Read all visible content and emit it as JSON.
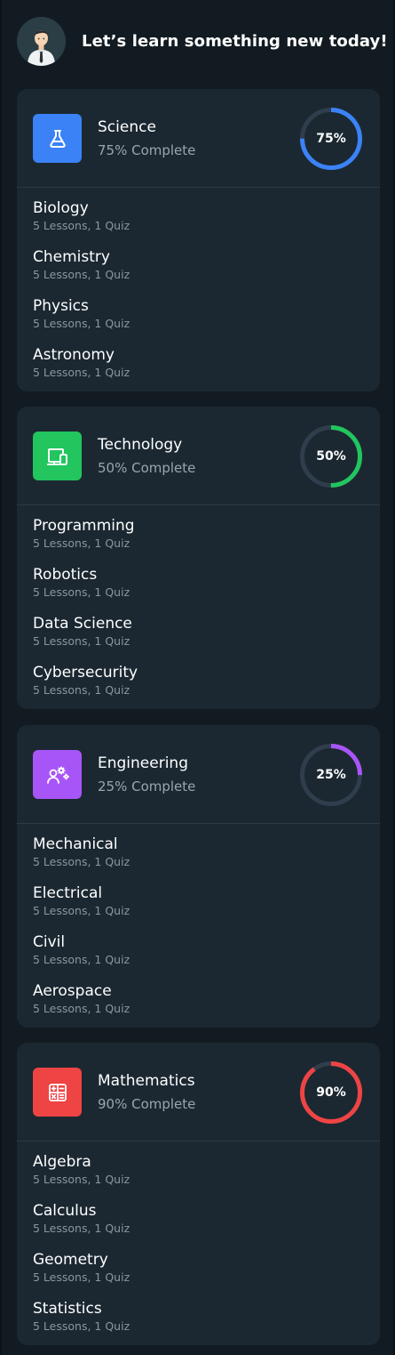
{
  "header": {
    "greeting": "Let’s learn something new today!",
    "avatar_icon": "user-avatar-icon"
  },
  "categories": [
    {
      "title": "Science",
      "subtitle": "75% Complete",
      "progress": 75,
      "progress_label": "75%",
      "color": "#3b82f6",
      "icon": "flask-icon",
      "topics": [
        {
          "name": "Biology",
          "meta": "5 Lessons, 1 Quiz"
        },
        {
          "name": "Chemistry",
          "meta": "5 Lessons, 1 Quiz"
        },
        {
          "name": "Physics",
          "meta": "5 Lessons, 1 Quiz"
        },
        {
          "name": "Astronomy",
          "meta": "5 Lessons, 1 Quiz"
        }
      ]
    },
    {
      "title": "Technology",
      "subtitle": "50% Complete",
      "progress": 50,
      "progress_label": "50%",
      "color": "#22c55e",
      "icon": "devices-icon",
      "topics": [
        {
          "name": "Programming",
          "meta": "5 Lessons, 1 Quiz"
        },
        {
          "name": "Robotics",
          "meta": "5 Lessons, 1 Quiz"
        },
        {
          "name": "Data Science",
          "meta": "5 Lessons, 1 Quiz"
        },
        {
          "name": "Cybersecurity",
          "meta": "5 Lessons, 1 Quiz"
        }
      ]
    },
    {
      "title": "Engineering",
      "subtitle": "25% Complete",
      "progress": 25,
      "progress_label": "25%",
      "color": "#a855f7",
      "icon": "engineer-gears-icon",
      "topics": [
        {
          "name": "Mechanical",
          "meta": "5 Lessons, 1 Quiz"
        },
        {
          "name": "Electrical",
          "meta": "5 Lessons, 1 Quiz"
        },
        {
          "name": "Civil",
          "meta": "5 Lessons, 1 Quiz"
        },
        {
          "name": "Aerospace",
          "meta": "5 Lessons, 1 Quiz"
        }
      ]
    },
    {
      "title": "Mathematics",
      "subtitle": "90% Complete",
      "progress": 90,
      "progress_label": "90%",
      "color": "#ef4444",
      "icon": "calculator-icon",
      "topics": [
        {
          "name": "Algebra",
          "meta": "5 Lessons, 1 Quiz"
        },
        {
          "name": "Calculus",
          "meta": "5 Lessons, 1 Quiz"
        },
        {
          "name": "Geometry",
          "meta": "5 Lessons, 1 Quiz"
        },
        {
          "name": "Statistics",
          "meta": "5 Lessons, 1 Quiz"
        }
      ]
    }
  ]
}
